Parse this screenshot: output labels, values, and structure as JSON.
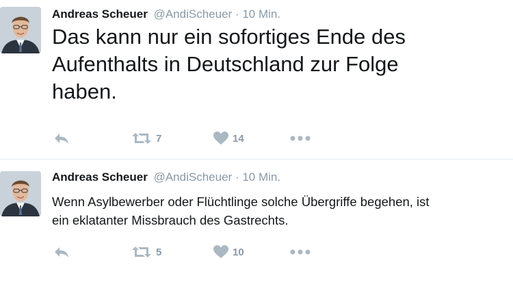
{
  "tweets": [
    {
      "author_name": "Andreas Scheuer",
      "handle": "@AndiScheuer",
      "separator": "·",
      "time": "10 Min.",
      "text": "Das kann nur ein sofortiges Ende des\nAufenthalts in Deutschland zur Folge\nhaben.",
      "retweet_count": "7",
      "like_count": "14"
    },
    {
      "author_name": "Andreas Scheuer",
      "handle": "@AndiScheuer",
      "separator": "·",
      "time": "10 Min.",
      "text": "Wenn Asylbewerber oder Flüchtlinge solche Übergriffe begehen, ist\nein eklatanter Missbrauch des Gastrechts.",
      "retweet_count": "5",
      "like_count": "10"
    }
  ],
  "icons": {
    "reply": "reply-icon",
    "retweet": "retweet-icon",
    "like": "heart-icon",
    "more": "more-icon"
  },
  "colors": {
    "text": "#14171a",
    "muted": "#8899a6",
    "icon": "#aab8c2",
    "divider": "#e6ecf0"
  }
}
